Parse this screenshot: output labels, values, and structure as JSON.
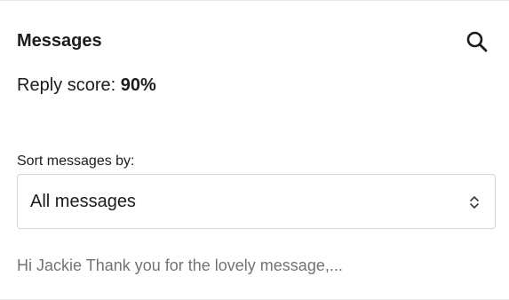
{
  "header": {
    "title": "Messages",
    "search_icon": "search-icon"
  },
  "reply_score": {
    "label": "Reply score: ",
    "value": "90%"
  },
  "sort": {
    "label": "Sort messages by:",
    "selected": "All messages",
    "icon": "chevron-up-down-icon"
  },
  "messages": [
    {
      "preview": "Hi Jackie Thank you for the lovely message,..."
    }
  ],
  "colors": {
    "text": "#1c1c1c",
    "muted_text": "#737373",
    "border": "#d4d4d4",
    "divider": "#e6e6e6",
    "background": "#ffffff"
  }
}
